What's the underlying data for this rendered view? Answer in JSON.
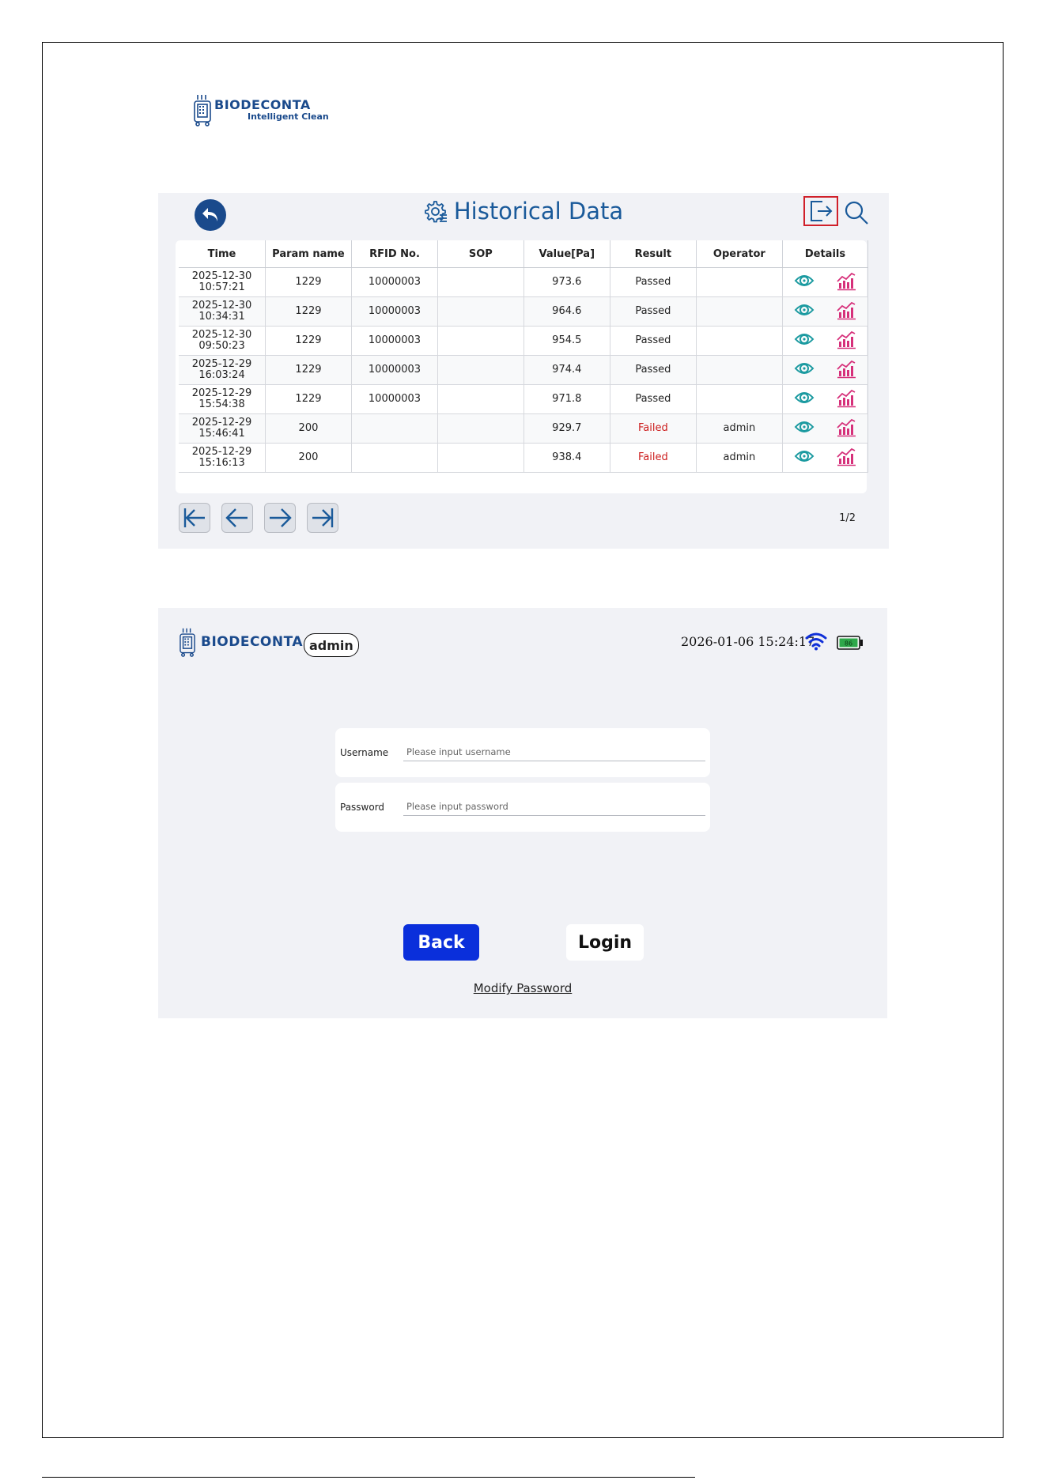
{
  "brand": {
    "name": "BIODECONTA",
    "tagline": "Intelligent Clean"
  },
  "historical": {
    "title": "Historical Data",
    "columns": [
      "Time",
      "Param name",
      "RFID No.",
      "SOP",
      "Value[Pa]",
      "Result",
      "Operator",
      "Details"
    ],
    "rows": [
      {
        "date": "2025-12-30",
        "time": "10:57:21",
        "param": "1229",
        "rfid": "10000003",
        "sop": "",
        "value": "973.6",
        "result": "Passed",
        "operator": ""
      },
      {
        "date": "2025-12-30",
        "time": "10:34:31",
        "param": "1229",
        "rfid": "10000003",
        "sop": "",
        "value": "964.6",
        "result": "Passed",
        "operator": ""
      },
      {
        "date": "2025-12-30",
        "time": "09:50:23",
        "param": "1229",
        "rfid": "10000003",
        "sop": "",
        "value": "954.5",
        "result": "Passed",
        "operator": ""
      },
      {
        "date": "2025-12-29",
        "time": "16:03:24",
        "param": "1229",
        "rfid": "10000003",
        "sop": "",
        "value": "974.4",
        "result": "Passed",
        "operator": ""
      },
      {
        "date": "2025-12-29",
        "time": "15:54:38",
        "param": "1229",
        "rfid": "10000003",
        "sop": "",
        "value": "971.8",
        "result": "Passed",
        "operator": ""
      },
      {
        "date": "2025-12-29",
        "time": "15:46:41",
        "param": "200",
        "rfid": "",
        "sop": "",
        "value": "929.7",
        "result": "Failed",
        "operator": "admin"
      },
      {
        "date": "2025-12-29",
        "time": "15:16:13",
        "param": "200",
        "rfid": "",
        "sop": "",
        "value": "938.4",
        "result": "Failed",
        "operator": "admin"
      }
    ],
    "page_indicator": "1/2",
    "colors": {
      "accent": "#1a5a9a",
      "failed": "#cc1c1c",
      "eye_icon": "#1b9aa0",
      "chart_icon": "#d6307a",
      "highlight": "#d0202a"
    }
  },
  "login": {
    "user_badge": "admin",
    "datetime": "2026-01-06 15:24:17",
    "battery_level": "86",
    "username_label": "Username",
    "username_placeholder": "Please input username",
    "password_label": "Password",
    "password_placeholder": "Please input password",
    "back_label": "Back",
    "login_label": "Login",
    "modify_label": "Modify Password",
    "colors": {
      "back_button": "#0a2fdb",
      "wifi": "#1030d8",
      "battery": "#2ea84a"
    }
  }
}
